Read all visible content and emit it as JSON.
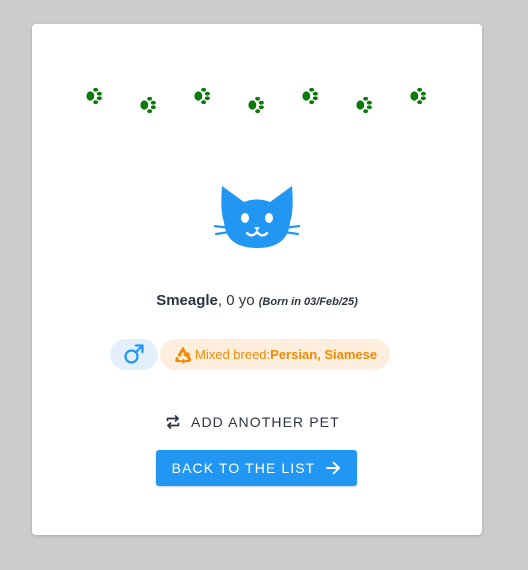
{
  "theme": {
    "paw_color": "#0a7a0a",
    "cat_color": "#2196f3",
    "accent": "#2196f3",
    "breed_color": "#f08a00"
  },
  "decorations": {
    "paw_icon": "paw-print-icon",
    "count": 7
  },
  "pet": {
    "avatar_icon": "cat-face-icon",
    "name": "Smeagle",
    "age_text": ", 0 yo",
    "born_text": "(Born in 03/Feb/25)",
    "gender_icon": "male-symbol-icon",
    "breed_icon": "recycle-icon",
    "breed_label": "Mixed breed:",
    "breed_values": "Persian, Siamese"
  },
  "actions": {
    "add_another_label": "ADD ANOTHER PET",
    "add_another_icon": "repeat-icon",
    "back_label": "BACK TO THE LIST",
    "back_icon": "arrow-right-icon"
  }
}
